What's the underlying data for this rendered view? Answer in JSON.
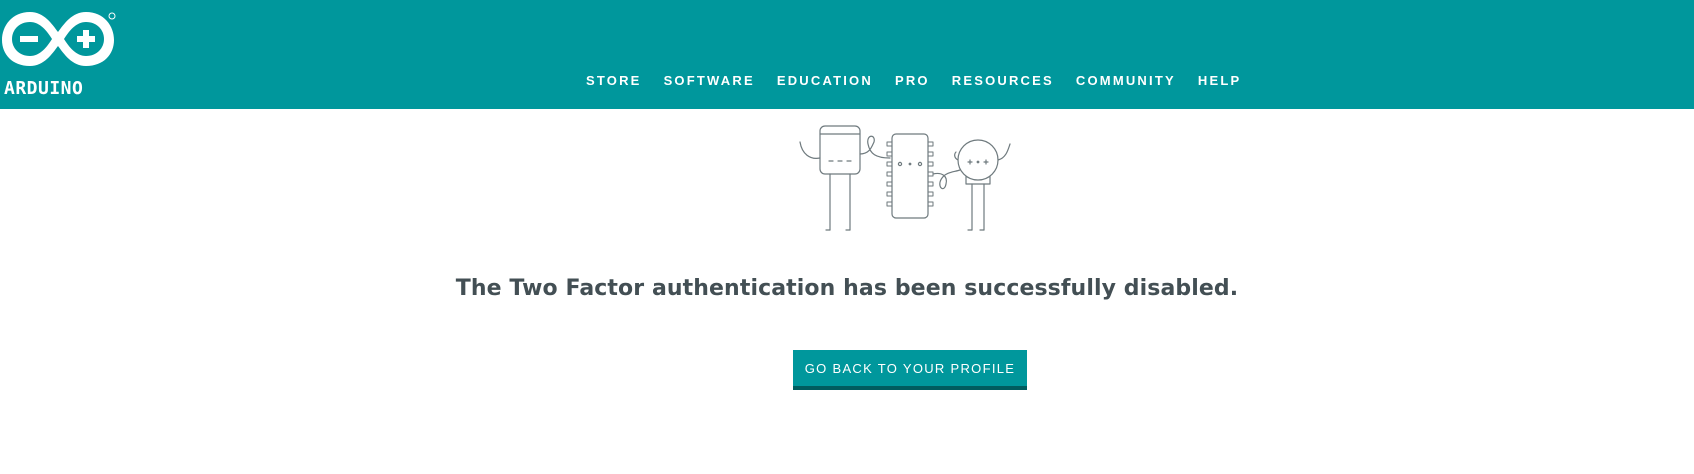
{
  "header": {
    "logo_text": "ARDUINO",
    "logo_icon": "arduino-infinity-logo",
    "background_color": "#00979c"
  },
  "nav": {
    "items": [
      {
        "label": "STORE"
      },
      {
        "label": "SOFTWARE"
      },
      {
        "label": "EDUCATION"
      },
      {
        "label": "PRO"
      },
      {
        "label": "RESOURCES"
      },
      {
        "label": "COMMUNITY"
      },
      {
        "label": "HELP"
      }
    ]
  },
  "main": {
    "illustration_icon": "arduino-components-illustration",
    "message": "The Two Factor authentication has been successfully disabled.",
    "button_label": "GO BACK TO YOUR PROFILE",
    "text_color": "#434f54",
    "accent_color": "#00979c"
  }
}
